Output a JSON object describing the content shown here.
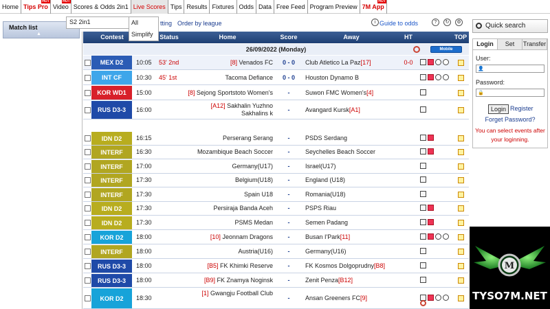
{
  "nav": [
    {
      "label": "Home",
      "red": false,
      "hot": false,
      "active": false
    },
    {
      "label": "Tips Pro",
      "red": true,
      "hot": true,
      "active": false
    },
    {
      "label": "Video",
      "red": false,
      "hot": true,
      "active": false
    },
    {
      "label": "Scores & Odds 2in1",
      "red": false,
      "hot": false,
      "active": false
    },
    {
      "label": "Live Scores",
      "red": false,
      "hot": false,
      "active": true
    },
    {
      "label": "Tips",
      "red": false,
      "hot": false,
      "active": false
    },
    {
      "label": "Results",
      "red": false,
      "hot": false,
      "active": false
    },
    {
      "label": "Fixtures",
      "red": false,
      "hot": false,
      "active": false
    },
    {
      "label": "Odds",
      "red": false,
      "hot": false,
      "active": false
    },
    {
      "label": "Data",
      "red": false,
      "hot": false,
      "active": false
    },
    {
      "label": "Free Feed",
      "red": false,
      "hot": false,
      "active": false
    },
    {
      "label": "Program Preview",
      "red": false,
      "hot": false,
      "active": false
    },
    {
      "label": "7M App",
      "red": true,
      "hot": true,
      "active": false
    }
  ],
  "hot_label": "HOT",
  "dropdown_value": "S2 2in1",
  "live_menu": [
    "All",
    "Simplify"
  ],
  "subbar": {
    "setting_fragment": "tting",
    "order_by_league": "Order by league",
    "guide_to_odds": "Guide to odds"
  },
  "match_list_label": "Match list",
  "table_headers": {
    "contest": "Contest",
    "status": "Status",
    "home": "Home",
    "score": "Score",
    "away": "Away",
    "ht": "HT",
    "top": "TOP"
  },
  "date_label": "26/09/2022 (Monday)",
  "mobile_label": "Mobile",
  "colors": {
    "mex": "#2a5db0",
    "intcf": "#3aa0e8",
    "korwd1": "#d8202a",
    "rusd33": "#1f4aa8",
    "idnd2": "#b7ac1e",
    "interf": "#b0a520",
    "kord2": "#18a0d6"
  },
  "matches": [
    {
      "contest": "MEX D2",
      "color": "#2b5cb5",
      "time": "10:05",
      "status": "53' 2nd",
      "home_rank": "[8]",
      "home": "Venados FC",
      "score": "0 - 0",
      "away": "Club Atletico La Paz",
      "away_rank": "[17]",
      "ht": "0-0",
      "icons": [
        "box",
        "red",
        "ball",
        "ball"
      ],
      "alt": true
    },
    {
      "contest": "INT CF",
      "color": "#3ea6ea",
      "time": "10:30",
      "status": "45' 1st",
      "home_rank": "",
      "home": "Tacoma Defiance",
      "score": "0 - 0",
      "away": "Houston Dynamo B",
      "away_rank": "",
      "ht": "",
      "icons": [
        "box",
        "red",
        "ball",
        "ball"
      ],
      "alt": false
    },
    {
      "contest": "KOR WD1",
      "color": "#d8202a",
      "time": "15:00",
      "status": "",
      "home_rank": "[8]",
      "home": "Sejong Sportstoto Women's",
      "score": "-",
      "away": "Suwon FMC Women's",
      "away_rank": "[4]",
      "ht": "",
      "icons": [
        "box"
      ],
      "alt": false
    },
    {
      "contest": "RUS D3-3",
      "color": "#1f4aa8",
      "time": "16:00",
      "status": "",
      "home_rank": "[A12]",
      "home": "Sakhalin Yuzhno Sakhalins k",
      "score": "-",
      "away": "Avangard Kursk",
      "away_rank": "[A1]",
      "ht": "",
      "icons": [
        "box"
      ],
      "alt": false
    },
    {
      "contest": "IDN D2",
      "color": "#b8ad1f",
      "time": "16:15",
      "status": "",
      "home_rank": "",
      "home": "Perserang Serang",
      "score": "-",
      "away": "PSDS Serdang",
      "away_rank": "",
      "ht": "",
      "icons": [
        "box",
        "red"
      ],
      "alt": false
    },
    {
      "contest": "INTERF",
      "color": "#b1a621",
      "time": "16:30",
      "status": "",
      "home_rank": "",
      "home": "Mozambique Beach Soccer",
      "score": "-",
      "away": "Seychelles Beach Soccer",
      "away_rank": "",
      "ht": "",
      "icons": [
        "box",
        "red"
      ],
      "alt": false
    },
    {
      "contest": "INTERF",
      "color": "#b1a621",
      "time": "17:00",
      "status": "",
      "home_rank": "",
      "home": "Germany(U17)",
      "score": "-",
      "away": "Israel(U17)",
      "away_rank": "",
      "ht": "",
      "icons": [
        "box"
      ],
      "alt": false
    },
    {
      "contest": "INTERF",
      "color": "#b1a621",
      "time": "17:30",
      "status": "",
      "home_rank": "",
      "home": "Belgium(U18)",
      "score": "-",
      "away": "England (U18)",
      "away_rank": "",
      "ht": "",
      "icons": [
        "box"
      ],
      "alt": false
    },
    {
      "contest": "INTERF",
      "color": "#b1a621",
      "time": "17:30",
      "status": "",
      "home_rank": "",
      "home": "Spain U18",
      "score": "-",
      "away": "Romania(U18)",
      "away_rank": "",
      "ht": "",
      "icons": [
        "box"
      ],
      "alt": false
    },
    {
      "contest": "IDN D2",
      "color": "#b8ad1f",
      "time": "17:30",
      "status": "",
      "home_rank": "",
      "home": "Persiraja Banda Aceh",
      "score": "-",
      "away": "PSPS Riau",
      "away_rank": "",
      "ht": "",
      "icons": [
        "box",
        "red"
      ],
      "alt": false
    },
    {
      "contest": "IDN D2",
      "color": "#b8ad1f",
      "time": "17:30",
      "status": "",
      "home_rank": "",
      "home": "PSMS Medan",
      "score": "-",
      "away": "Semen Padang",
      "away_rank": "",
      "ht": "",
      "icons": [
        "box",
        "red"
      ],
      "alt": false
    },
    {
      "contest": "KOR D2",
      "color": "#17a3d9",
      "time": "18:00",
      "status": "",
      "home_rank": "[10]",
      "home": "Jeonnam Dragons",
      "score": "-",
      "away": "Busan I'Park",
      "away_rank": "[11]",
      "ht": "",
      "icons": [
        "box",
        "red",
        "ball",
        "ball"
      ],
      "alt": false
    },
    {
      "contest": "INTERF",
      "color": "#b1a621",
      "time": "18:00",
      "status": "",
      "home_rank": "",
      "home": "Austria(U16)",
      "score": "-",
      "away": "Germany(U16)",
      "away_rank": "",
      "ht": "",
      "icons": [
        "box"
      ],
      "alt": false
    },
    {
      "contest": "RUS D3-3",
      "color": "#1f4aa8",
      "time": "18:00",
      "status": "",
      "home_rank": "[B5]",
      "home": "FK Khimki Reserve",
      "score": "-",
      "away": "FK Kosmos Dolgoprudny",
      "away_rank": "[B8]",
      "ht": "",
      "icons": [
        "box"
      ],
      "alt": false
    },
    {
      "contest": "RUS D3-3",
      "color": "#1f4aa8",
      "time": "18:00",
      "status": "",
      "home_rank": "[B9]",
      "home": "FK Znamya Noginsk",
      "score": "-",
      "away": "Zenit Penza",
      "away_rank": "[B12]",
      "ht": "",
      "icons": [
        "box"
      ],
      "alt": false
    },
    {
      "contest": "KOR D2",
      "color": "#17a3d9",
      "time": "18:30",
      "status": "",
      "home_rank": "[1]",
      "home": "Gwangju Football Club",
      "score": "-",
      "away": "Ansan Greeners FC",
      "away_rank": "[9]",
      "ht": "",
      "icons": [
        "box",
        "red",
        "ball",
        "ball"
      ],
      "alt": false
    }
  ],
  "right": {
    "quick_search": "Quick search",
    "tabs": [
      "Login",
      "Set",
      "Transfer"
    ],
    "user_label": "User:",
    "password_label": "Password:",
    "login_btn": "Login",
    "register": "Register",
    "forgot": "Forget Password?",
    "note": "You can select events after your loginning."
  },
  "logo_text": "TYSO7M.NET"
}
